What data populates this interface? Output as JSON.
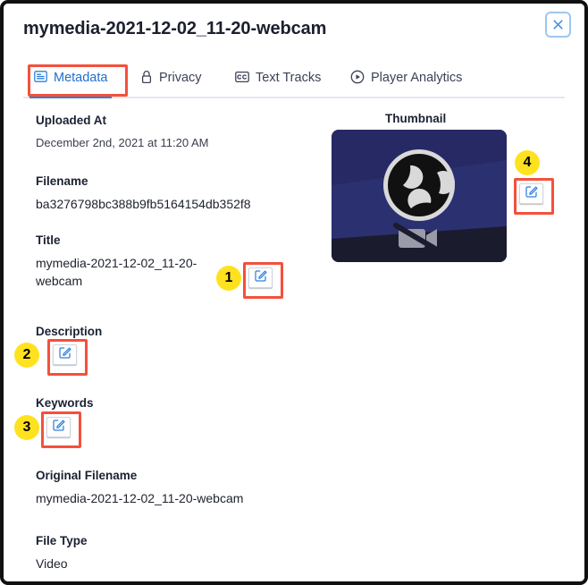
{
  "modal": {
    "title": "mymedia-2021-12-02_11-20-webcam",
    "close_icon": "close-icon",
    "close_label": "×"
  },
  "tabs": [
    {
      "label": "Metadata",
      "icon": "document-text-icon",
      "active": true,
      "highlighted": true
    },
    {
      "label": "Privacy",
      "icon": "lock-icon",
      "active": false,
      "highlighted": false
    },
    {
      "label": "Text Tracks",
      "icon": "closed-caption-icon",
      "active": false,
      "highlighted": false
    },
    {
      "label": "Player Analytics",
      "icon": "play-circle-icon",
      "active": false,
      "highlighted": false
    }
  ],
  "fields": {
    "uploaded_at": {
      "label": "Uploaded At",
      "value": "December 2nd, 2021 at 11:20 AM"
    },
    "filename": {
      "label": "Filename",
      "value": "ba3276798bc388b9fb5164154db352f8"
    },
    "title": {
      "label": "Title",
      "value": "mymedia-2021-12-02_11-20-webcam"
    },
    "description": {
      "label": "Description",
      "value": "-"
    },
    "keywords": {
      "label": "Keywords",
      "value": "-"
    },
    "original_filename": {
      "label": "Original Filename",
      "value": "mymedia-2021-12-02_11-20-webcam"
    },
    "file_type": {
      "label": "File Type",
      "value": "Video"
    }
  },
  "thumbnail": {
    "label": "Thumbnail",
    "image_description": "obs-studio-logo-on-dark-blue-background-with-camera-off-icon",
    "band_top_color": "#262963",
    "band_mid_color": "#2b3070",
    "band_bottom_color": "#1b1b2e"
  },
  "edit_buttons": [
    {
      "name": "edit-title-button",
      "icon": "pencil-square-icon",
      "badge": "1"
    },
    {
      "name": "edit-description-button",
      "icon": "pencil-square-icon",
      "badge": "2"
    },
    {
      "name": "edit-keywords-button",
      "icon": "pencil-square-icon",
      "badge": "3"
    },
    {
      "name": "edit-thumbnail-button",
      "icon": "pencil-square-icon",
      "badge": "4"
    }
  ],
  "badges": {
    "b1": "1",
    "b2": "2",
    "b3": "3",
    "b4": "4"
  },
  "colors": {
    "accent_blue": "#2f7fe0",
    "highlight_red": "#f4503c",
    "badge_yellow": "#ffe21f",
    "text_dark": "#1b2132"
  }
}
